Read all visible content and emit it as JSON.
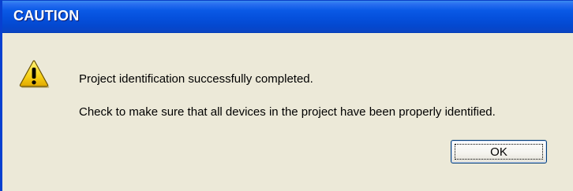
{
  "dialog": {
    "title": "CAUTION",
    "icon": "warning-icon",
    "message_line1": "Project identification successfully completed.",
    "message_line2": "Check to make sure that all devices in the project have been properly identified.",
    "ok_label": "OK"
  },
  "colors": {
    "titlebar": "#0550dc",
    "body": "#ece9d8",
    "warning_yellow": "#f7d117"
  }
}
